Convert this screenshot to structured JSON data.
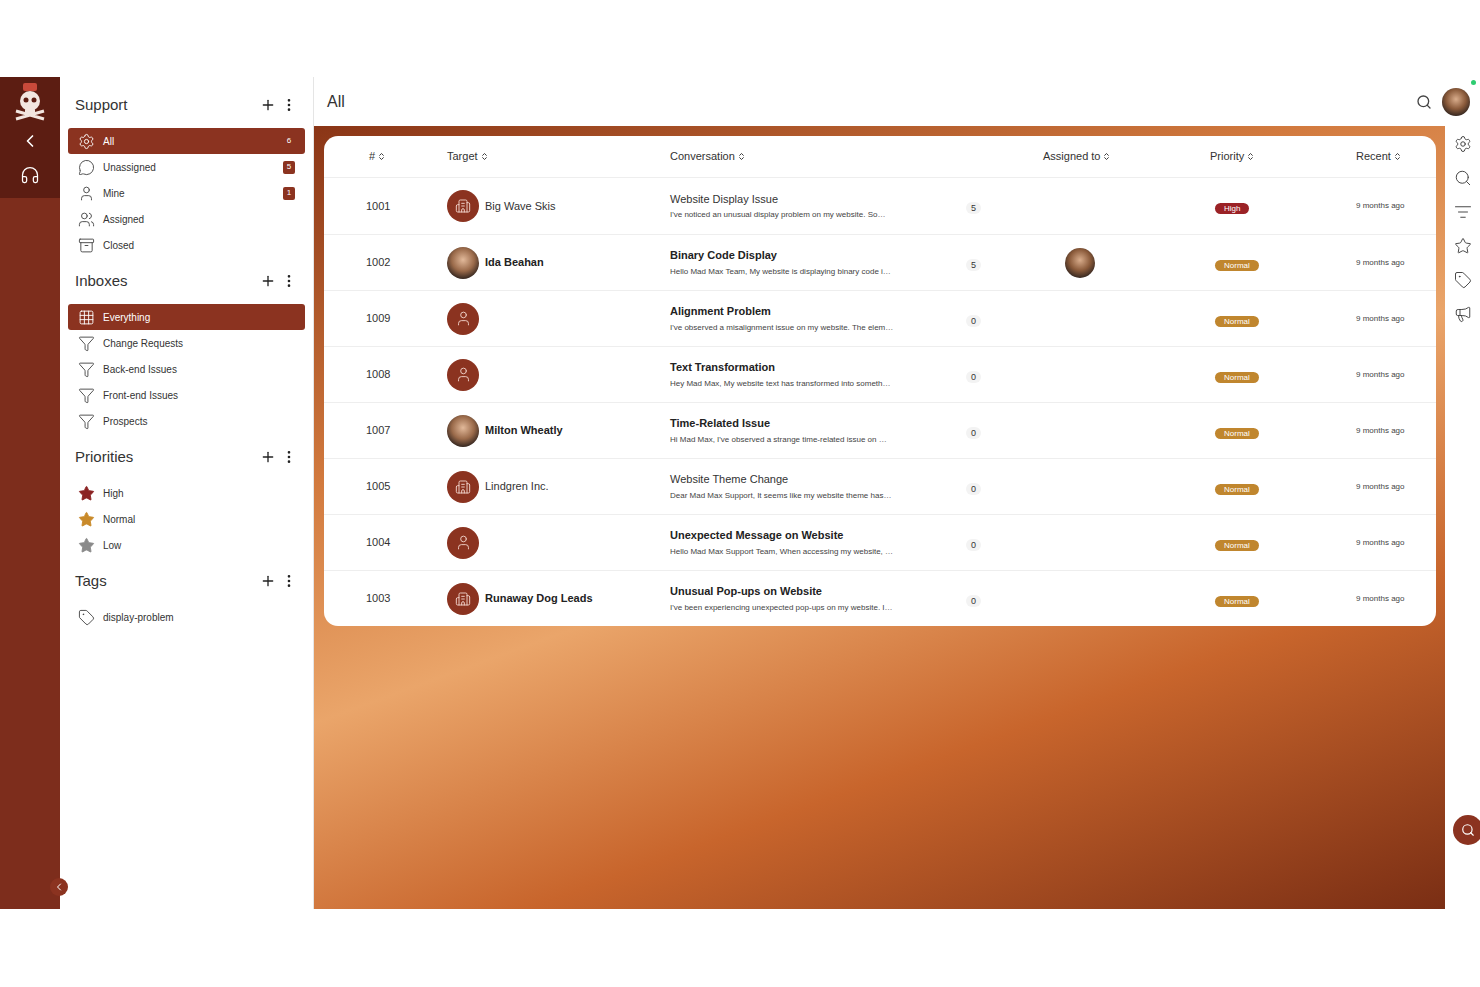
{
  "header": {
    "title": "All"
  },
  "sidebar": {
    "sections": [
      {
        "title": "Support",
        "items": [
          {
            "label": "All",
            "count": "6",
            "count_boxed": false,
            "selected": true
          },
          {
            "label": "Unassigned",
            "count": "5",
            "count_boxed": true,
            "selected": false
          },
          {
            "label": "Mine",
            "count": "1",
            "count_boxed": true,
            "selected": false
          },
          {
            "label": "Assigned",
            "count": "",
            "count_boxed": false,
            "selected": false
          },
          {
            "label": "Closed",
            "count": "",
            "count_boxed": false,
            "selected": false
          }
        ]
      },
      {
        "title": "Inboxes",
        "items": [
          {
            "label": "Everything",
            "count": "",
            "count_boxed": false,
            "selected": true
          },
          {
            "label": "Change Requests",
            "count": "",
            "count_boxed": false,
            "selected": false
          },
          {
            "label": "Back-end Issues",
            "count": "",
            "count_boxed": false,
            "selected": false
          },
          {
            "label": "Front-end Issues",
            "count": "",
            "count_boxed": false,
            "selected": false
          },
          {
            "label": "Prospects",
            "count": "",
            "count_boxed": false,
            "selected": false
          }
        ]
      },
      {
        "title": "Priorities",
        "items": [
          {
            "label": "High",
            "count": "",
            "count_boxed": false,
            "selected": false,
            "color": "#8b2323"
          },
          {
            "label": "Normal",
            "count": "",
            "count_boxed": false,
            "selected": false,
            "color": "#c98a2a"
          },
          {
            "label": "Low",
            "count": "",
            "count_boxed": false,
            "selected": false,
            "color": "#8a8a8a"
          }
        ]
      },
      {
        "title": "Tags",
        "items": [
          {
            "label": "display-problem",
            "count": "",
            "count_boxed": false,
            "selected": false
          }
        ]
      }
    ]
  },
  "table": {
    "columns": [
      "#",
      "Target",
      "Conversation",
      "",
      "Assigned to",
      "Priority",
      "Recent"
    ],
    "rows": [
      {
        "id": "1001",
        "target": "Big Wave Skis",
        "kind": "company",
        "subject": "Website Display Issue",
        "preview": "I've noticed an unusual display problem on my website. So…",
        "unread": false,
        "count": "5",
        "assigned": false,
        "priority": "High",
        "priority_color": "#9b2226",
        "recent": "9 months ago"
      },
      {
        "id": "1002",
        "target": "Ida Beahan",
        "kind": "person",
        "subject": "Binary Code Display",
        "preview": "Hello Mad Max Team, My website is displaying binary code i…",
        "unread": true,
        "count": "5",
        "assigned": true,
        "priority": "Normal",
        "priority_color": "#c0862e",
        "recent": "9 months ago"
      },
      {
        "id": "1009",
        "target": "",
        "kind": "anonymous",
        "subject": "Alignment Problem",
        "preview": "I've observed a misalignment issue on my website. The elem…",
        "unread": true,
        "count": "0",
        "assigned": false,
        "priority": "Normal",
        "priority_color": "#c0862e",
        "recent": "9 months ago"
      },
      {
        "id": "1008",
        "target": "",
        "kind": "anonymous",
        "subject": "Text Transformation",
        "preview": "Hey Mad Max, My website text has transformed into someth…",
        "unread": true,
        "count": "0",
        "assigned": false,
        "priority": "Normal",
        "priority_color": "#c0862e",
        "recent": "9 months ago"
      },
      {
        "id": "1007",
        "target": "Milton Wheatly",
        "kind": "person",
        "subject": "Time-Related Issue",
        "preview": "Hi Mad Max, I've observed a strange time-related issue on …",
        "unread": true,
        "count": "0",
        "assigned": false,
        "priority": "Normal",
        "priority_color": "#c0862e",
        "recent": "9 months ago"
      },
      {
        "id": "1005",
        "target": "Lindgren Inc.",
        "kind": "company",
        "subject": "Website Theme Change",
        "preview": "Dear Mad Max Support, It seems like my website theme has…",
        "unread": false,
        "count": "0",
        "assigned": false,
        "priority": "Normal",
        "priority_color": "#c0862e",
        "recent": "9 months ago"
      },
      {
        "id": "1004",
        "target": "",
        "kind": "anonymous",
        "subject": "Unexpected Message on Website",
        "preview": "Hello Mad Max Support Team, When accessing my website, …",
        "unread": true,
        "count": "0",
        "assigned": false,
        "priority": "Normal",
        "priority_color": "#c0862e",
        "recent": "9 months ago"
      },
      {
        "id": "1003",
        "target": "Runaway Dog Leads",
        "kind": "company",
        "subject": "Unusual Pop-ups on Website",
        "preview": "I've been experiencing unexpected pop-ups on my website. I…",
        "unread": true,
        "count": "0",
        "assigned": false,
        "priority": "Normal",
        "priority_color": "#c0862e",
        "recent": "9 months ago"
      }
    ]
  }
}
